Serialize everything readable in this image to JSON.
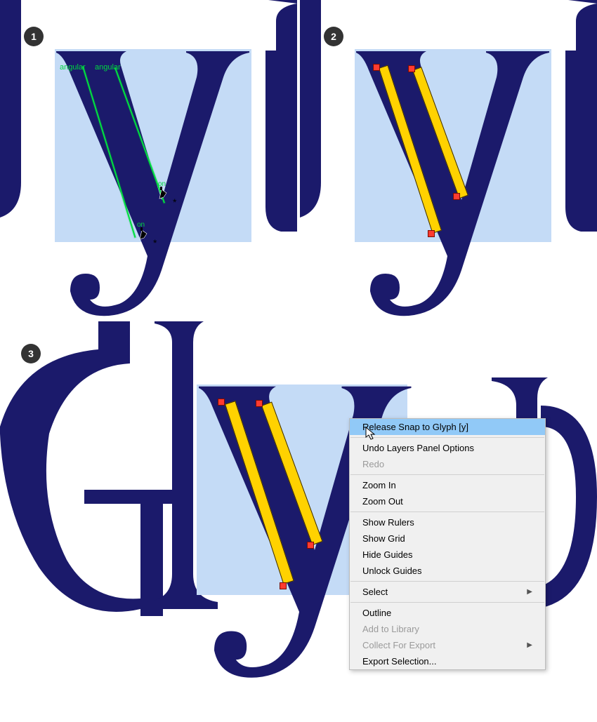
{
  "colors": {
    "glyph_dark": "#1b1a6b",
    "edit_bg": "#c4dbf6",
    "guide_green": "#00e040",
    "stroke_yellow": "#ffd200",
    "handle_red": "#ff3b30",
    "menu_highlight": "#91c9f7"
  },
  "panels": {
    "p1": {
      "badge": "1"
    },
    "p2": {
      "badge": "2"
    },
    "p3": {
      "badge": "3"
    }
  },
  "labels": {
    "angular_left": "angular",
    "angular_right": "angular",
    "on_upper": "on",
    "on_lower": "on",
    "asterisk": "*"
  },
  "context_menu": {
    "items": [
      {
        "label": "Release Snap to Glyph [y]",
        "highlight": true,
        "disabled": false
      },
      {
        "sep": true
      },
      {
        "label": "Undo Layers Panel Options",
        "disabled": false
      },
      {
        "label": "Redo",
        "disabled": true
      },
      {
        "sep": true
      },
      {
        "label": "Zoom In",
        "disabled": false
      },
      {
        "label": "Zoom Out",
        "disabled": false
      },
      {
        "sep": true
      },
      {
        "label": "Show Rulers",
        "disabled": false
      },
      {
        "label": "Show Grid",
        "disabled": false
      },
      {
        "label": "Hide Guides",
        "disabled": false
      },
      {
        "label": "Unlock Guides",
        "disabled": false
      },
      {
        "sep": true
      },
      {
        "label": "Select",
        "disabled": false,
        "submenu": true
      },
      {
        "sep": true
      },
      {
        "label": "Outline",
        "disabled": false
      },
      {
        "label": "Add to Library",
        "disabled": true
      },
      {
        "label": "Collect For Export",
        "disabled": true,
        "submenu": true
      },
      {
        "label": "Export Selection...",
        "disabled": false
      }
    ]
  }
}
